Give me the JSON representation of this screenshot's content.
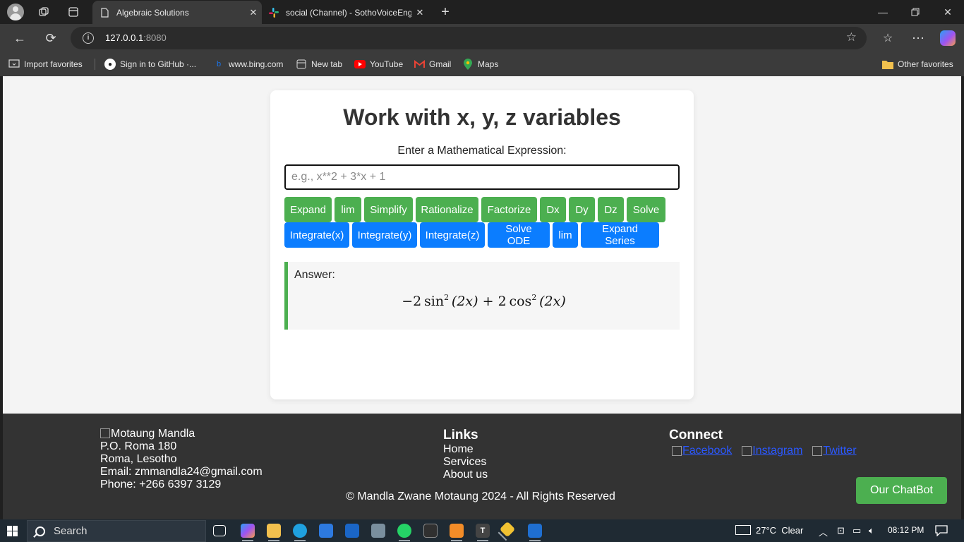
{
  "browser": {
    "tabs": [
      {
        "title": "Algebraic Solutions",
        "active": true
      },
      {
        "title": "social (Channel) - SothoVoiceEngi",
        "active": false
      }
    ],
    "url_host": "127.0.0.1",
    "url_port": ":8080",
    "favorites": [
      {
        "label": "Import favorites",
        "icon": "import-icon"
      },
      {
        "label": "Sign in to GitHub ·...",
        "icon": "github-icon"
      },
      {
        "label": "www.bing.com",
        "icon": "bing-icon"
      },
      {
        "label": "New tab",
        "icon": "new-tab-icon"
      },
      {
        "label": "YouTube",
        "icon": "youtube-icon"
      },
      {
        "label": "Gmail",
        "icon": "gmail-icon"
      },
      {
        "label": "Maps",
        "icon": "maps-icon"
      }
    ],
    "other_favorites": "Other favorites"
  },
  "page": {
    "title": "Work with x, y, z variables",
    "input_label": "Enter a Mathematical Expression:",
    "input_placeholder": "e.g., x**2 + 3*x + 1",
    "input_value": "",
    "buttons_row1": [
      "Expand",
      "lim",
      "Simplify",
      "Rationalize",
      "Factorize",
      "Dx",
      "Dy",
      "Dz",
      "Solve"
    ],
    "buttons_row2": [
      "Integrate(x)",
      "Integrate(y)",
      "Integrate(z)",
      "Solve ODE",
      "lim",
      "Expand Series"
    ],
    "answer_label": "Answer:",
    "answer": {
      "t1_sign": "−2",
      "t1_func": "sin",
      "exp": "2",
      "t1_arg": "(2x)",
      "op": "+",
      "t2_coef": "2",
      "t2_func": "cos",
      "t2_arg": "(2x)"
    }
  },
  "footer": {
    "logo_alt": "Motaung Mandla",
    "address": [
      "P.O. Roma 180",
      "Roma, Lesotho"
    ],
    "email": "Email: zmmandla24@gmail.com",
    "phone": "Phone: +266 6397 3129",
    "links_title": "Links",
    "links": [
      "Home",
      "Services",
      "About us"
    ],
    "connect_title": "Connect",
    "social": [
      "Facebook",
      "Instagram",
      "Twitter"
    ],
    "copyright": "© Mandla Zwane Motaung 2024 - All Rights Reserved",
    "chatbot": "Our ChatBot"
  },
  "taskbar": {
    "search_placeholder": "Search",
    "weather": "27°C",
    "weather_text": "Clear",
    "time": "08:12 PM"
  },
  "colors": {
    "green": "#4caf50",
    "blue": "#0b7dff",
    "footer_bg": "#333333"
  }
}
